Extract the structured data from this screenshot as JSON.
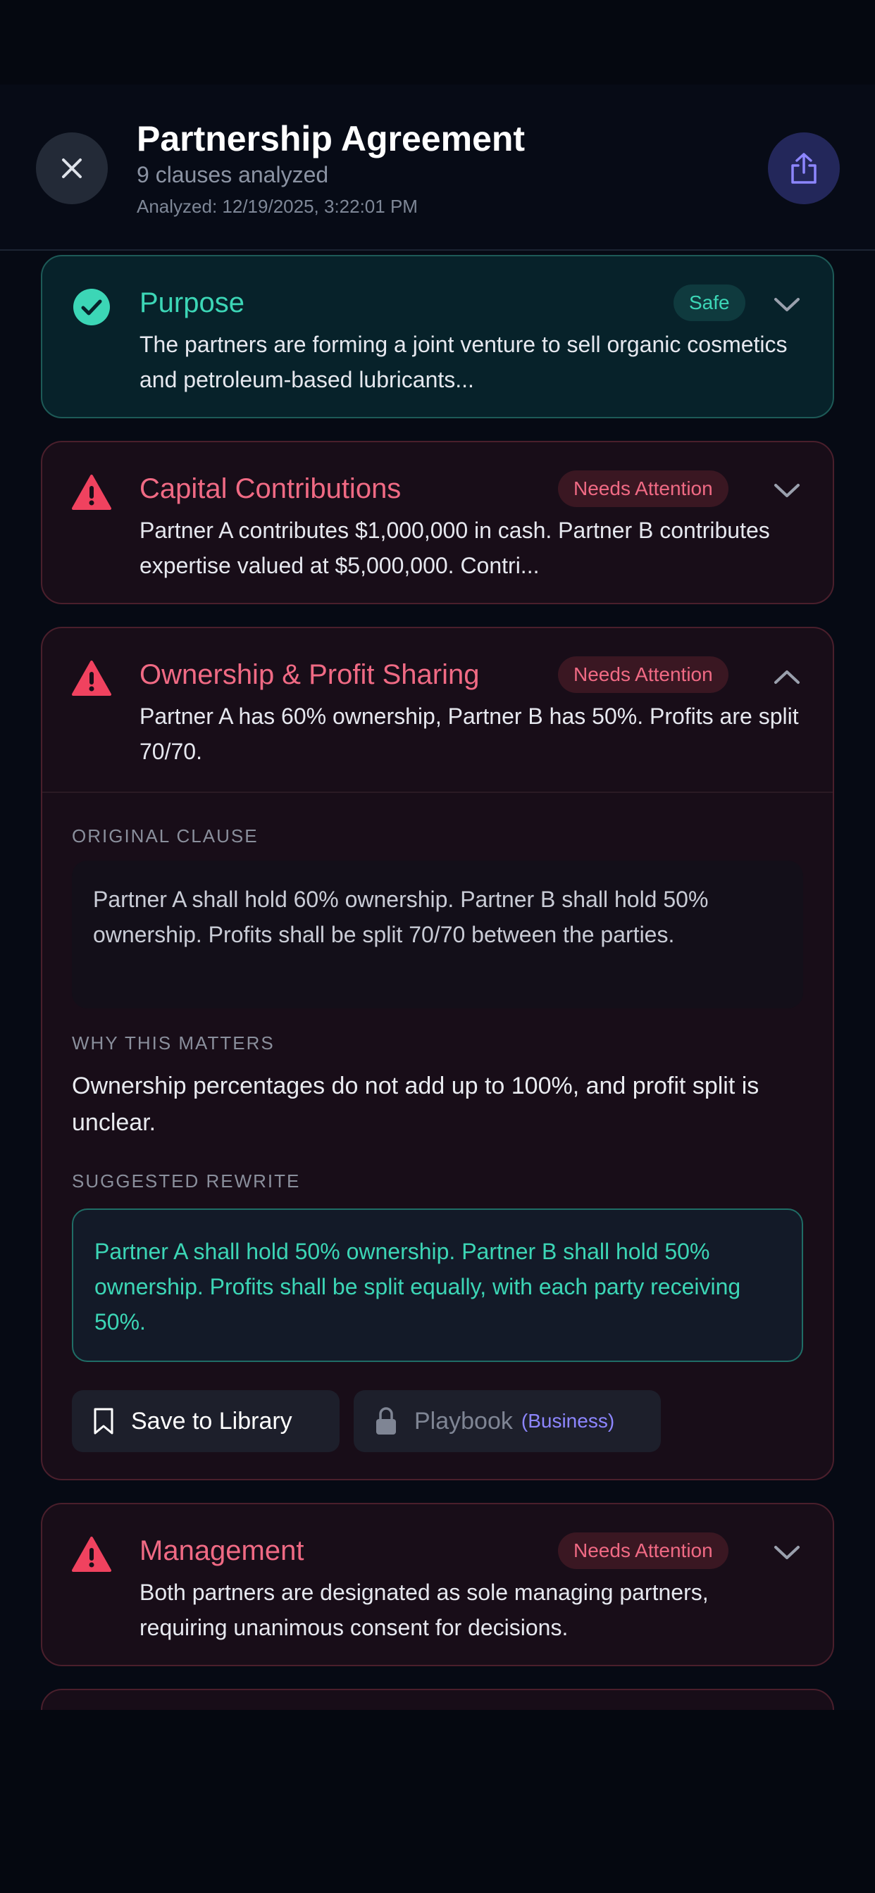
{
  "header": {
    "title": "Partnership Agreement",
    "subtitle": "9 clauses analyzed",
    "analyzed": "Analyzed: 12/19/2025, 3:22:01 PM"
  },
  "colors": {
    "safe": "#3cd6b6",
    "attention": "#f06a84",
    "accent": "#8d86ff"
  },
  "clauses": [
    {
      "title": "Purpose",
      "status": "Safe",
      "summary": "The partners are forming a joint venture to sell organic cosmetics and petroleum-based lubricants...",
      "icon": "check-circle-icon",
      "expanded": false
    },
    {
      "title": "Capital Contributions",
      "status": "Needs Attention",
      "summary": "Partner A contributes $1,000,000 in cash. Partner B contributes expertise valued at $5,000,000. Contri...",
      "icon": "warning-icon",
      "expanded": false
    },
    {
      "title": "Ownership & Profit Sharing",
      "status": "Needs Attention",
      "summary": "Partner A has 60% ownership, Partner B has 50%. Profits are split 70/70.",
      "icon": "warning-icon",
      "expanded": true,
      "original_label": "ORIGINAL CLAUSE",
      "original_text": "Partner A shall hold 60% ownership. Partner B shall hold 50% ownership. Profits shall be split 70/70 between the parties.",
      "why_label": "WHY THIS MATTERS",
      "why_text": "Ownership percentages do not add up to 100%, and profit split is unclear.",
      "rewrite_label": "SUGGESTED REWRITE",
      "rewrite_text": "Partner A shall hold 50% ownership. Partner B shall hold 50% ownership. Profits shall be split equally, with each party receiving 50%.",
      "save_label": "Save to Library",
      "playbook_label": "Playbook",
      "playbook_tier": "(Business)"
    },
    {
      "title": "Management",
      "status": "Needs Attention",
      "summary": "Both partners are designated as sole managing partners, requiring unanimous consent for decisions.",
      "icon": "warning-icon",
      "expanded": false
    }
  ]
}
